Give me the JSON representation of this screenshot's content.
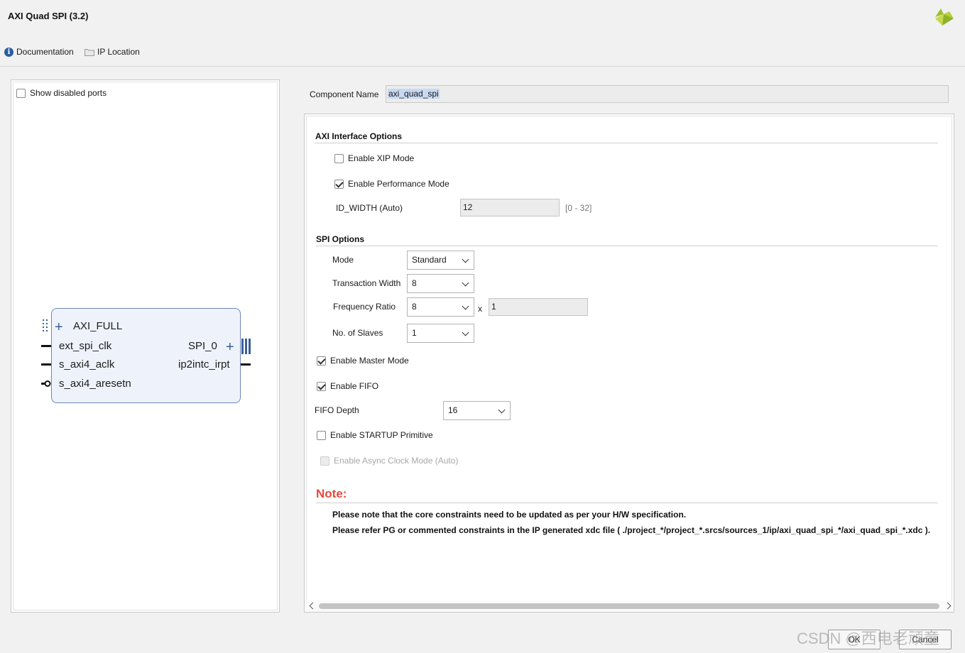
{
  "window": {
    "title": "AXI Quad SPI (3.2)"
  },
  "links": {
    "documentation": "Documentation",
    "ip_location": "IP Location"
  },
  "symbol_panel": {
    "show_disabled_ports": "Show disabled ports",
    "show_disabled_checked": false,
    "block": {
      "left_ports": [
        "AXI_FULL",
        "ext_spi_clk",
        "s_axi4_aclk",
        "s_axi4_aresetn"
      ],
      "right_ports": [
        "SPI_0",
        "ip2intc_irpt"
      ]
    }
  },
  "component": {
    "label": "Component Name",
    "value": "axi_quad_spi"
  },
  "axi_interface": {
    "title": "AXI Interface Options",
    "enable_xip_mode": {
      "label": "Enable XIP Mode",
      "checked": false
    },
    "enable_performance_mode": {
      "label": "Enable Performance Mode",
      "checked": true
    },
    "id_width": {
      "label": "ID_WIDTH (Auto)",
      "value": "12",
      "range": "[0 - 32]"
    }
  },
  "spi_options": {
    "title": "SPI Options",
    "mode": {
      "label": "Mode",
      "value": "Standard"
    },
    "transaction_width": {
      "label": "Transaction Width",
      "value": "8"
    },
    "frequency_ratio": {
      "label": "Frequency Ratio",
      "value": "8",
      "times": "x",
      "multiplier": "1"
    },
    "no_of_slaves": {
      "label": "No. of Slaves",
      "value": "1"
    },
    "enable_master_mode": {
      "label": "Enable Master Mode",
      "checked": true
    },
    "enable_fifo": {
      "label": "Enable FIFO",
      "checked": true
    },
    "fifo_depth": {
      "label": "FIFO Depth",
      "value": "16"
    },
    "enable_startup_primitive": {
      "label": "Enable STARTUP Primitive",
      "checked": false
    },
    "enable_async_clock_mode": {
      "label": "Enable Async Clock Mode (Auto)",
      "checked": false,
      "disabled": true
    }
  },
  "note": {
    "title": "Note:",
    "line1": "Please note that the core constraints need to be updated as per your H/W specification.",
    "line2": "Please refer PG or commented constraints in the IP generated xdc file ( ./project_*/project_*.srcs/sources_1/ip/axi_quad_spi_*/axi_quad_spi_*.xdc )."
  },
  "buttons": {
    "ok": "OK",
    "cancel": "Cancel"
  },
  "watermark": "CSDN @西电老顽童",
  "colors": {
    "note_red": "#e8483c",
    "block_fill": "#eef3fb",
    "block_border": "#6d86b8",
    "selection": "#c7d9f3"
  }
}
